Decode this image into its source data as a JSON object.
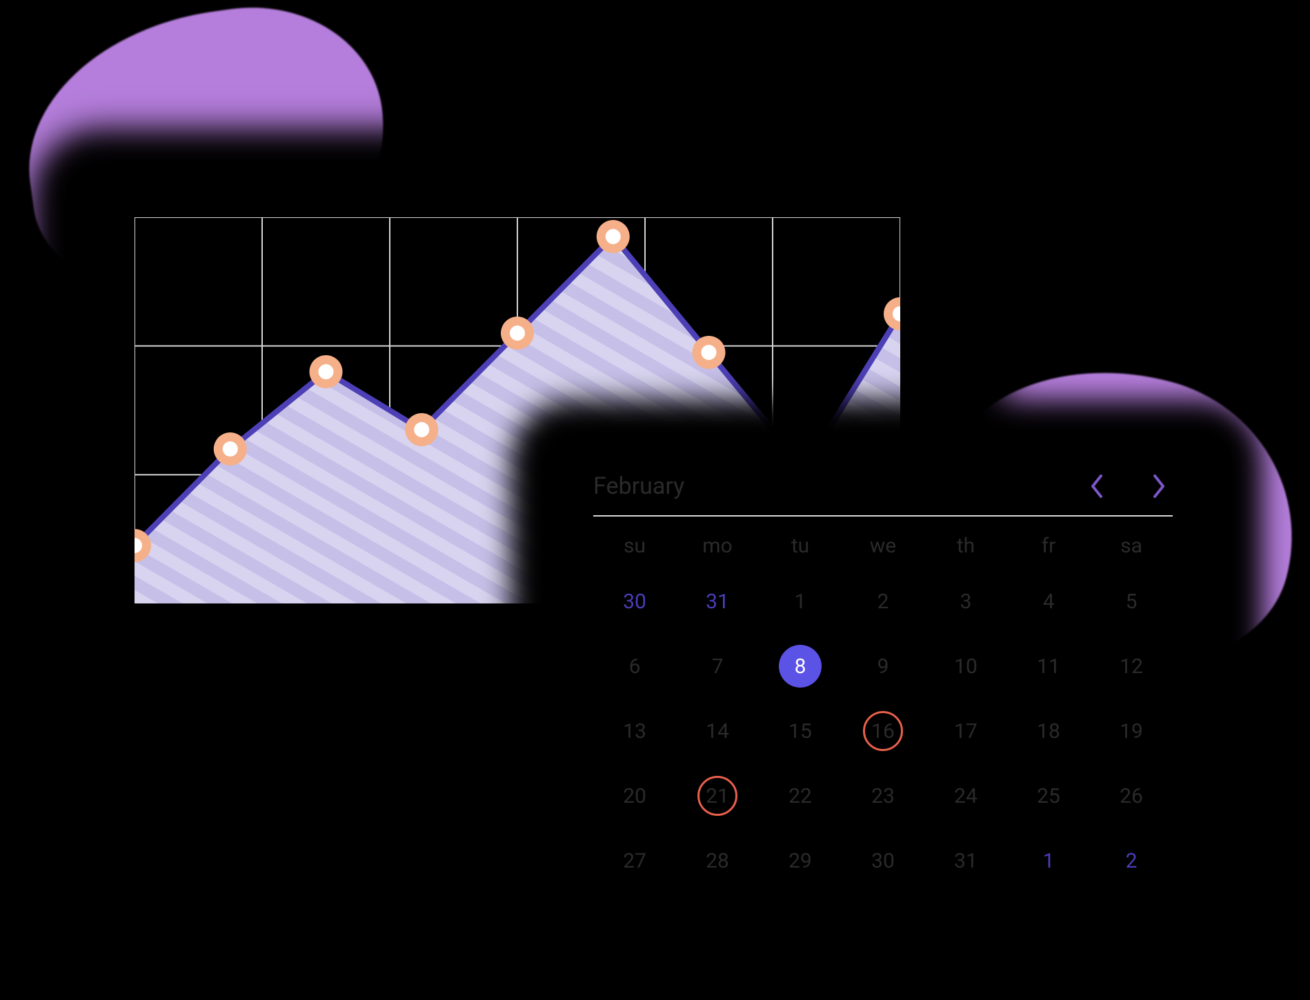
{
  "colors": {
    "accent_purple": "#b57edc",
    "chart_line": "#4d3fb5",
    "chart_fill": "#d8d4f0",
    "dot": "#f5b08a",
    "selected_bg": "#5b52e6",
    "marked_ring": "#e8604c",
    "nav_arrow": "#7b57c7"
  },
  "chart_data": {
    "type": "area",
    "x": [
      0,
      1,
      2,
      3,
      4,
      5,
      6,
      7
    ],
    "values": [
      15,
      40,
      60,
      45,
      70,
      95,
      65,
      35,
      75
    ],
    "ylim": [
      0,
      100
    ],
    "grid_rows": 3,
    "grid_cols": 6,
    "title": "",
    "xlabel": "",
    "ylabel": ""
  },
  "calendar": {
    "month_label": "February",
    "weekdays": [
      "su",
      "mo",
      "tu",
      "we",
      "th",
      "fr",
      "sa"
    ],
    "days": [
      {
        "n": 30,
        "other": true
      },
      {
        "n": 31,
        "other": true
      },
      {
        "n": 1
      },
      {
        "n": 2
      },
      {
        "n": 3
      },
      {
        "n": 4
      },
      {
        "n": 5
      },
      {
        "n": 6
      },
      {
        "n": 7
      },
      {
        "n": 8,
        "selected": true
      },
      {
        "n": 9
      },
      {
        "n": 10
      },
      {
        "n": 11
      },
      {
        "n": 12
      },
      {
        "n": 13
      },
      {
        "n": 14
      },
      {
        "n": 15
      },
      {
        "n": 16,
        "marked": true
      },
      {
        "n": 17
      },
      {
        "n": 18
      },
      {
        "n": 19
      },
      {
        "n": 20
      },
      {
        "n": 21,
        "marked": true
      },
      {
        "n": 22
      },
      {
        "n": 23
      },
      {
        "n": 24
      },
      {
        "n": 25
      },
      {
        "n": 26
      },
      {
        "n": 27
      },
      {
        "n": 28
      },
      {
        "n": 29
      },
      {
        "n": 30
      },
      {
        "n": 31
      },
      {
        "n": 1,
        "other": true
      },
      {
        "n": 2,
        "other": true
      }
    ]
  }
}
